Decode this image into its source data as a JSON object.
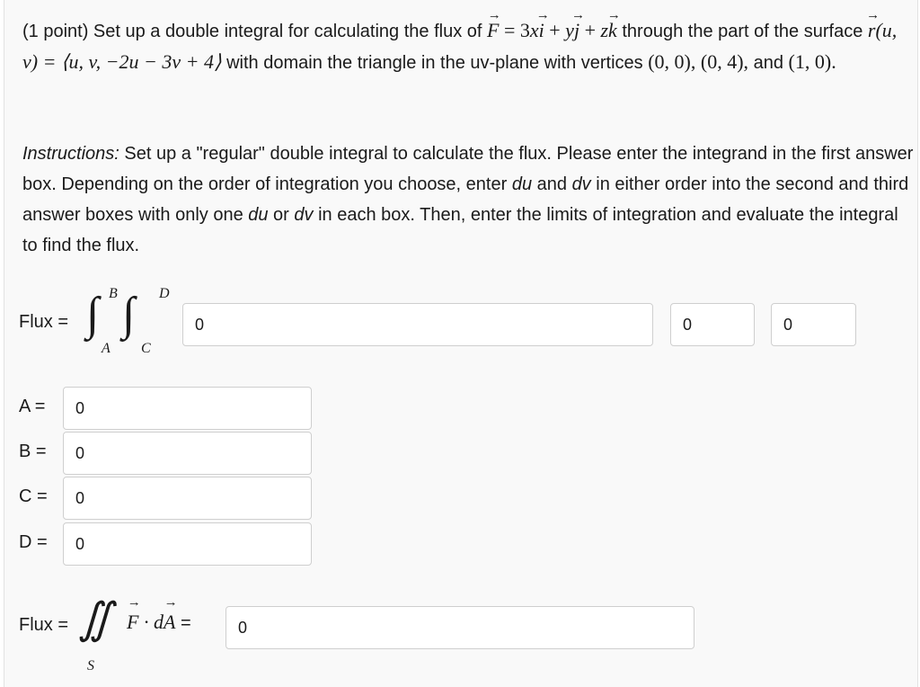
{
  "problem": {
    "prefix": "(1 point) Set up a double integral for calculating the flux of ",
    "field_name": "F",
    "equals": " = 3",
    "x": "x",
    "i": "i",
    "plus1": " + ",
    "y": "y",
    "j": "j",
    "plus2": " + ",
    "z": "z",
    "k": "k",
    "through": " through the part of the surface ",
    "r": "r",
    "param": "(u, v) = ⟨u, v, −2u − 3v + 4⟩",
    "domain_text": " with domain the triangle in the uv-plane with vertices ",
    "vertices": "(0, 0), (0, 4),",
    "and": " and ",
    "last_vertex": "(1, 0)",
    "period": "."
  },
  "instructions": {
    "lead": "Instructions:",
    "text1": " Set up a \"regular\" double integral to calculate the flux. Please enter the integrand in the first answer box. Depending on the order of integration you choose, enter ",
    "du1": "du",
    "and1": " and ",
    "dv1": "dv",
    "text2": " in either order into the second and third answer boxes with only one ",
    "du2": "du",
    "or": " or ",
    "dv2": "dv",
    "text3": " in each box. Then, enter the limits of integration and evaluate the integral to find the flux."
  },
  "flux_setup": {
    "label": "Flux =",
    "upper_outer": "B",
    "lower_outer": "A",
    "upper_inner": "D",
    "lower_inner": "C",
    "integrand_value": "0",
    "diff1_value": "0",
    "diff2_value": "0"
  },
  "limits": [
    {
      "label": "A =",
      "value": "0"
    },
    {
      "label": "B =",
      "value": "0"
    },
    {
      "label": "C =",
      "value": "0"
    },
    {
      "label": "D =",
      "value": "0"
    }
  ],
  "flux_result": {
    "label": "Flux =",
    "integral": "∬",
    "region": "S",
    "F": "F",
    "dot": " · d",
    "A": "A",
    "equals": " =",
    "value": "0"
  }
}
